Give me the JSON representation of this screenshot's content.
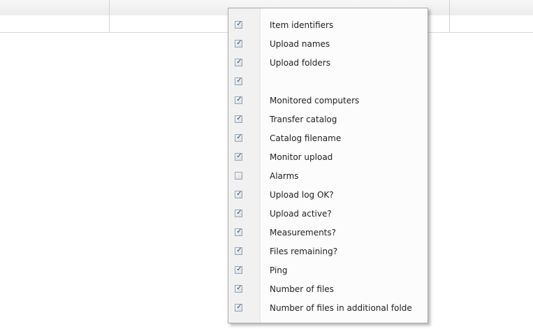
{
  "menu": {
    "items": [
      {
        "label": "Item identifiers",
        "checked": true,
        "mark": "✓"
      },
      {
        "label": "Upload names",
        "checked": true,
        "mark": "✓"
      },
      {
        "label": "Upload folders",
        "checked": true,
        "mark": "✓"
      },
      {
        "label": "",
        "checked": true,
        "mark": "✓"
      },
      {
        "label": "Monitored computers",
        "checked": true,
        "mark": "✓"
      },
      {
        "label": "Transfer catalog",
        "checked": true,
        "mark": "✓"
      },
      {
        "label": "Catalog filename",
        "checked": true,
        "mark": "✓"
      },
      {
        "label": "Monitor upload",
        "checked": true,
        "mark": "✓"
      },
      {
        "label": "Alarms",
        "checked": false,
        "mark": "✓"
      },
      {
        "label": "Upload log OK?",
        "checked": true,
        "mark": "✓"
      },
      {
        "label": "Upload active?",
        "checked": true,
        "mark": "✓"
      },
      {
        "label": "Measurements?",
        "checked": true,
        "mark": "✓"
      },
      {
        "label": "Files remaining?",
        "checked": true,
        "mark": "✓"
      },
      {
        "label": "Ping",
        "checked": true,
        "mark": "✓"
      },
      {
        "label": "Number of files",
        "checked": true,
        "mark": "✓"
      },
      {
        "label": "Number of files in additional folde",
        "checked": true,
        "mark": "✓"
      }
    ]
  },
  "icons": {
    "checkbox": "checkbox-icon"
  }
}
